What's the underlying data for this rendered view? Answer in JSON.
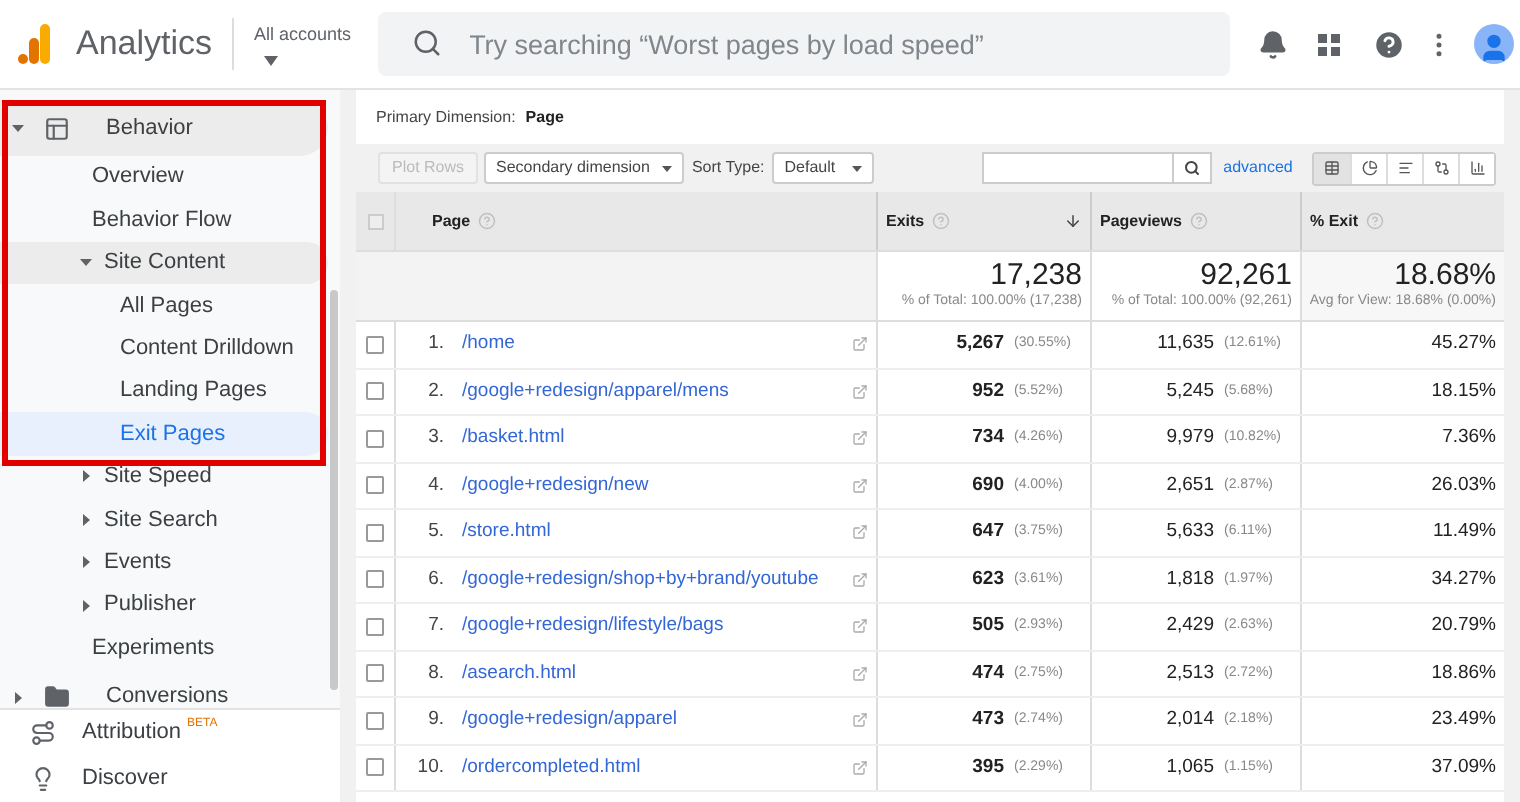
{
  "header": {
    "app_name": "Analytics",
    "account_label": "All accounts",
    "search_placeholder": "Try searching “Worst pages by load speed”"
  },
  "sidebar": {
    "items": [
      {
        "label": "Behavior",
        "expanded": true,
        "selected": false,
        "children": [
          {
            "label": "Overview",
            "selected": false
          },
          {
            "label": "Behavior Flow",
            "selected": false
          },
          {
            "label": "Site Content",
            "expanded": true,
            "selected": false,
            "children": [
              {
                "label": "All Pages",
                "selected": false
              },
              {
                "label": "Content Drilldown",
                "selected": false
              },
              {
                "label": "Landing Pages",
                "selected": false
              },
              {
                "label": "Exit Pages",
                "selected": true
              }
            ]
          },
          {
            "label": "Site Speed",
            "expanded": false,
            "selected": false
          },
          {
            "label": "Site Search",
            "expanded": false,
            "selected": false
          },
          {
            "label": "Events",
            "expanded": false,
            "selected": false
          },
          {
            "label": "Publisher",
            "expanded": false,
            "selected": false
          },
          {
            "label": "Experiments",
            "selected": false
          }
        ]
      },
      {
        "label": "Conversions",
        "expanded": false,
        "selected": false
      }
    ],
    "footer_items": [
      {
        "label": "Attribution",
        "badge": "BETA"
      },
      {
        "label": "Discover"
      }
    ]
  },
  "report": {
    "primary_dimension": {
      "label": "Primary Dimension:",
      "value": "Page"
    },
    "toolbar": {
      "plot_rows": {
        "label": "Plot Rows",
        "disabled": true
      },
      "secondary_dimension": "Secondary dimension",
      "sort_type_label": "Sort Type:",
      "sort_type": "Default",
      "advanced_link": "advanced",
      "view_buttons": [
        {
          "selected": true
        },
        {
          "selected": false
        },
        {
          "selected": false
        },
        {
          "selected": false
        },
        {
          "selected": false
        }
      ]
    },
    "table": {
      "select_all_checked": false,
      "columns": [
        {
          "label": "Page",
          "sorted": false
        },
        {
          "label": "Exits",
          "sorted": true
        },
        {
          "label": "Pageviews",
          "sorted": false
        },
        {
          "label": "% Exit",
          "sorted": false
        }
      ],
      "totals": [
        {
          "value": "17,238",
          "note": "% of Total: 100.00% (17,238)"
        },
        {
          "value": "92,261",
          "note": "% of Total: 100.00% (92,261)"
        },
        {
          "value": "18.68%",
          "note": "Avg for View: 18.68% (0.00%)"
        }
      ],
      "rows": [
        {
          "index": "1.",
          "page": "/home",
          "exits": "5,267",
          "exits_share": "(30.55%)",
          "pageviews": "11,635",
          "pageviews_share": "(12.61%)",
          "exit_rate": "45.27%",
          "checked": false
        },
        {
          "index": "2.",
          "page": "/google+redesign/apparel/mens",
          "exits": "952",
          "exits_share": "(5.52%)",
          "pageviews": "5,245",
          "pageviews_share": "(5.68%)",
          "exit_rate": "18.15%",
          "checked": false
        },
        {
          "index": "3.",
          "page": "/basket.html",
          "exits": "734",
          "exits_share": "(4.26%)",
          "pageviews": "9,979",
          "pageviews_share": "(10.82%)",
          "exit_rate": "7.36%",
          "checked": false
        },
        {
          "index": "4.",
          "page": "/google+redesign/new",
          "exits": "690",
          "exits_share": "(4.00%)",
          "pageviews": "2,651",
          "pageviews_share": "(2.87%)",
          "exit_rate": "26.03%",
          "checked": false
        },
        {
          "index": "5.",
          "page": "/store.html",
          "exits": "647",
          "exits_share": "(3.75%)",
          "pageviews": "5,633",
          "pageviews_share": "(6.11%)",
          "exit_rate": "11.49%",
          "checked": false
        },
        {
          "index": "6.",
          "page": "/google+redesign/shop+by+brand/youtube",
          "exits": "623",
          "exits_share": "(3.61%)",
          "pageviews": "1,818",
          "pageviews_share": "(1.97%)",
          "exit_rate": "34.27%",
          "checked": false
        },
        {
          "index": "7.",
          "page": "/google+redesign/lifestyle/bags",
          "exits": "505",
          "exits_share": "(2.93%)",
          "pageviews": "2,429",
          "pageviews_share": "(2.63%)",
          "exit_rate": "20.79%",
          "checked": false
        },
        {
          "index": "8.",
          "page": "/asearch.html",
          "exits": "474",
          "exits_share": "(2.75%)",
          "pageviews": "2,513",
          "pageviews_share": "(2.72%)",
          "exit_rate": "18.86%",
          "checked": false
        },
        {
          "index": "9.",
          "page": "/google+redesign/apparel",
          "exits": "473",
          "exits_share": "(2.74%)",
          "pageviews": "2,014",
          "pageviews_share": "(2.18%)",
          "exit_rate": "23.49%",
          "checked": false
        },
        {
          "index": "10.",
          "page": "/ordercompleted.html",
          "exits": "395",
          "exits_share": "(2.29%)",
          "pageviews": "1,065",
          "pageviews_share": "(1.15%)",
          "exit_rate": "37.09%",
          "checked": false
        }
      ]
    }
  }
}
